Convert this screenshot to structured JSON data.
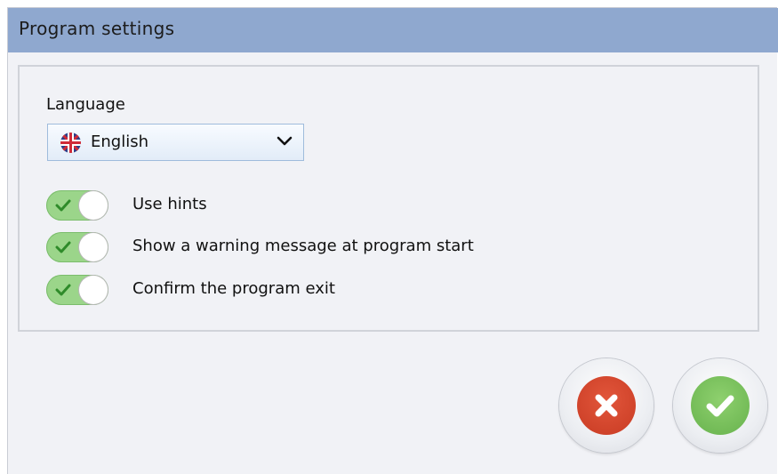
{
  "window": {
    "title": "Program settings"
  },
  "language": {
    "label": "Language",
    "selected": "English",
    "flag_icon": "uk-flag-icon"
  },
  "options": [
    {
      "label": "Use hints",
      "enabled": true
    },
    {
      "label": "Show a warning message at program start",
      "enabled": true
    },
    {
      "label": "Confirm the program exit",
      "enabled": true
    }
  ],
  "buttons": {
    "cancel_icon": "close-icon",
    "ok_icon": "check-icon"
  },
  "colors": {
    "titlebar": "#8fa8cf",
    "toggle_on": "#9bd58a",
    "cancel": "#c83b23",
    "ok": "#67b24d"
  }
}
